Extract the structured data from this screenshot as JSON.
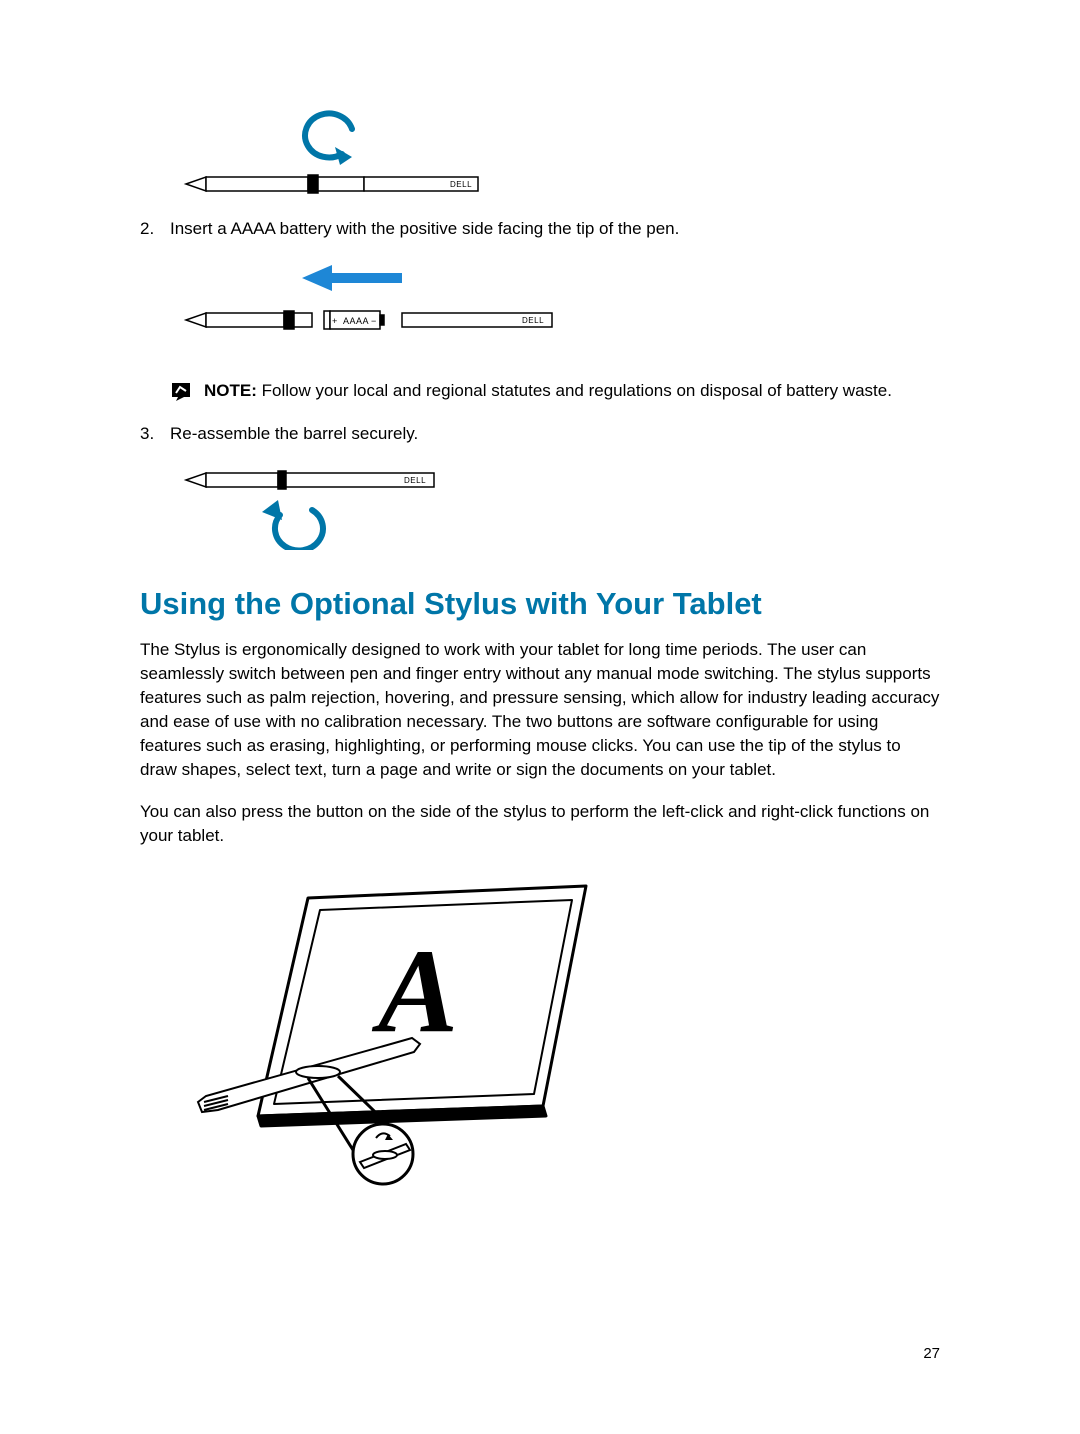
{
  "steps": {
    "s2": {
      "num": "2.",
      "text": "Insert a AAAA battery with the positive side facing the tip of the pen."
    },
    "note": {
      "label": "NOTE: ",
      "text": "Follow your local and regional statutes and regulations on disposal of battery waste."
    },
    "s3": {
      "num": "3.",
      "text": "Re-assemble the barrel securely."
    }
  },
  "figures": {
    "pen_brand": "DELL",
    "battery_label": "AAAA",
    "battery_plus": "+",
    "battery_minus": "−",
    "letter": "A"
  },
  "section": {
    "heading": "Using the Optional Stylus with Your Tablet",
    "p1": "The Stylus is ergonomically designed to work with your tablet for long time periods. The user can seamlessly switch between pen and finger entry without any manual mode switching.  The stylus supports features such as palm rejection, hovering, and pressure sensing, which allow for industry leading accuracy and ease of use with no calibration necessary.  The two buttons are software configurable for using features such as erasing, highlighting, or performing mouse clicks. You can use the tip of the stylus to draw shapes, select text, turn a page and write or sign the documents on your tablet.",
    "p2": "You can also press the button on the side of the stylus to perform the left-click and right-click functions on your tablet."
  },
  "page_number": "27"
}
